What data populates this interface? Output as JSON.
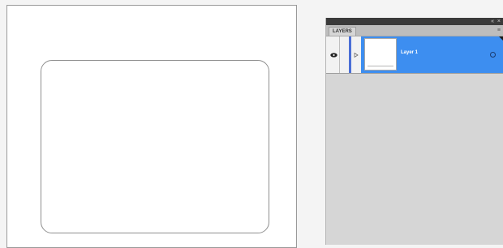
{
  "layers_panel": {
    "tab_label": "LAYERS",
    "titlebar_buttons": "«  ×",
    "menu_icon": "≡",
    "layers": [
      {
        "name": "Layer 1",
        "visible": true,
        "selected": true,
        "color": "#4a6fd6"
      }
    ]
  },
  "colors": {
    "selection": "#3d8ef0",
    "panel_bg": "#d6d6d6",
    "titlebar": "#3a3a3a"
  }
}
